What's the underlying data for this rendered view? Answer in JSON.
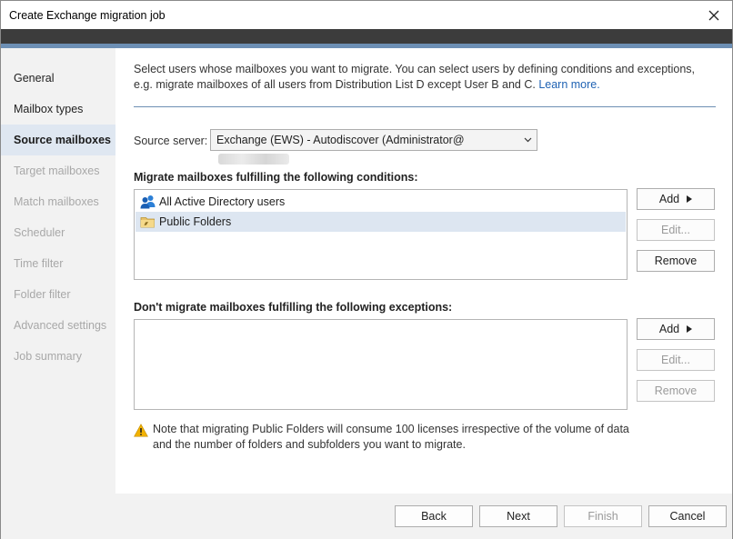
{
  "window": {
    "title": "Create Exchange migration job"
  },
  "sidebar": {
    "items": [
      {
        "label": "General",
        "state": "enabled"
      },
      {
        "label": "Mailbox types",
        "state": "enabled"
      },
      {
        "label": "Source mailboxes",
        "state": "active"
      },
      {
        "label": "Target mailboxes",
        "state": "disabled"
      },
      {
        "label": "Match mailboxes",
        "state": "disabled"
      },
      {
        "label": "Scheduler",
        "state": "disabled"
      },
      {
        "label": "Time filter",
        "state": "disabled"
      },
      {
        "label": "Folder filter",
        "state": "disabled"
      },
      {
        "label": "Advanced settings",
        "state": "disabled"
      },
      {
        "label": "Job summary",
        "state": "disabled"
      }
    ]
  },
  "intro": {
    "text": "Select users whose mailboxes you want to migrate. You can select users by defining conditions and exceptions, e.g. migrate mailboxes of all users from Distribution List D except User B and C.",
    "link": "Learn more."
  },
  "source": {
    "label": "Source server:",
    "value": "Exchange (EWS) - Autodiscover (Administrator@"
  },
  "conditions": {
    "title": "Migrate mailboxes fulfilling the following conditions:",
    "items": [
      {
        "label": "All Active Directory users",
        "icon": "users-icon",
        "selected": false
      },
      {
        "label": "Public Folders",
        "icon": "public-folder-icon",
        "selected": true
      }
    ],
    "buttons": {
      "add": "Add",
      "edit": "Edit...",
      "remove": "Remove"
    }
  },
  "exceptions": {
    "title": "Don't migrate mailboxes fulfilling the following exceptions:",
    "items": [],
    "buttons": {
      "add": "Add",
      "edit": "Edit...",
      "remove": "Remove"
    }
  },
  "note": {
    "text": "Note that migrating Public Folders will consume 100 licenses irrespective of the volume of data and the number of folders and subfolders you want to migrate."
  },
  "footer": {
    "back": "Back",
    "next": "Next",
    "finish": "Finish",
    "cancel": "Cancel"
  },
  "colors": {
    "accent": "#6d8fb4",
    "link": "#1f62b3",
    "selection": "#dde6f1",
    "warning": "#f2b200"
  }
}
